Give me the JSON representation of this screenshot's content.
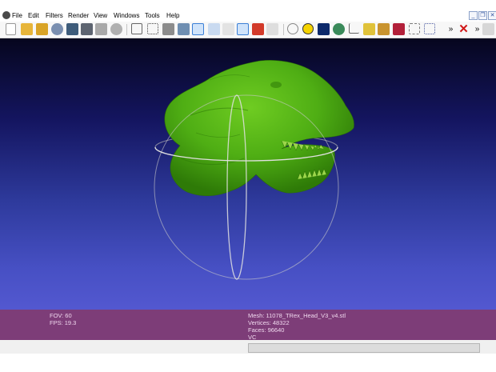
{
  "menubar": {
    "items": [
      "File",
      "Edit",
      "Filters",
      "Render",
      "View",
      "Windows",
      "Tools",
      "Help"
    ],
    "window_controls": [
      "_",
      "❐",
      "✕"
    ]
  },
  "toolbar": {
    "overflow_1": "»",
    "overflow_2": "»"
  },
  "info": {
    "fov": "FOV: 60",
    "fps": "FPS:   19.3",
    "mesh": "Mesh: 11078_TRex_Head_V3_v4.stl",
    "vertices": "Vertices: 48322",
    "faces": "Faces: 96640",
    "vc": "VC"
  },
  "colors": {
    "mesh_green": "#4fae14",
    "info_bar": "#7d3d78",
    "trackball": "#c8c8c8"
  }
}
